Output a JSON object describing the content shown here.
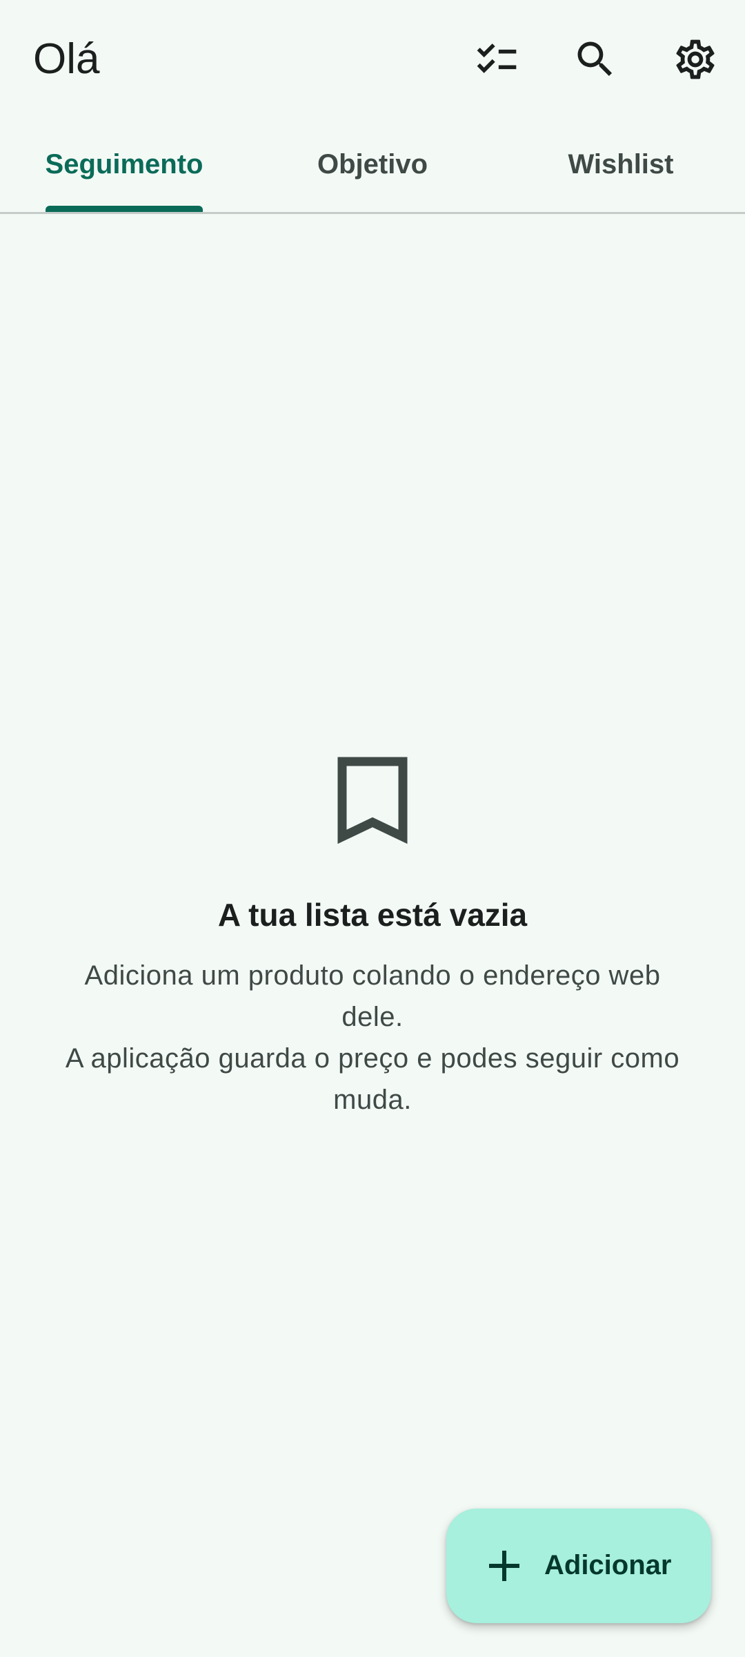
{
  "app_bar": {
    "title": "Olá",
    "actions": [
      {
        "icon": "checklist-icon"
      },
      {
        "icon": "search-icon"
      },
      {
        "icon": "gear-icon"
      }
    ]
  },
  "tabs": [
    {
      "label": "Seguimento",
      "selected": true
    },
    {
      "label": "Objetivo",
      "selected": false
    },
    {
      "label": "Wishlist",
      "selected": false
    }
  ],
  "empty_state": {
    "icon": "bookmark-icon",
    "title": "A tua lista está vazia",
    "body": "Adiciona um produto colando o endereço web dele.\nA aplicação guarda o preço e podes seguir como muda."
  },
  "fab": {
    "icon": "plus-icon",
    "label": "Adicionar"
  },
  "colors": {
    "background": "#f3f9f5",
    "accent": "#0a6b58",
    "fab_background": "#a6f0dd"
  }
}
